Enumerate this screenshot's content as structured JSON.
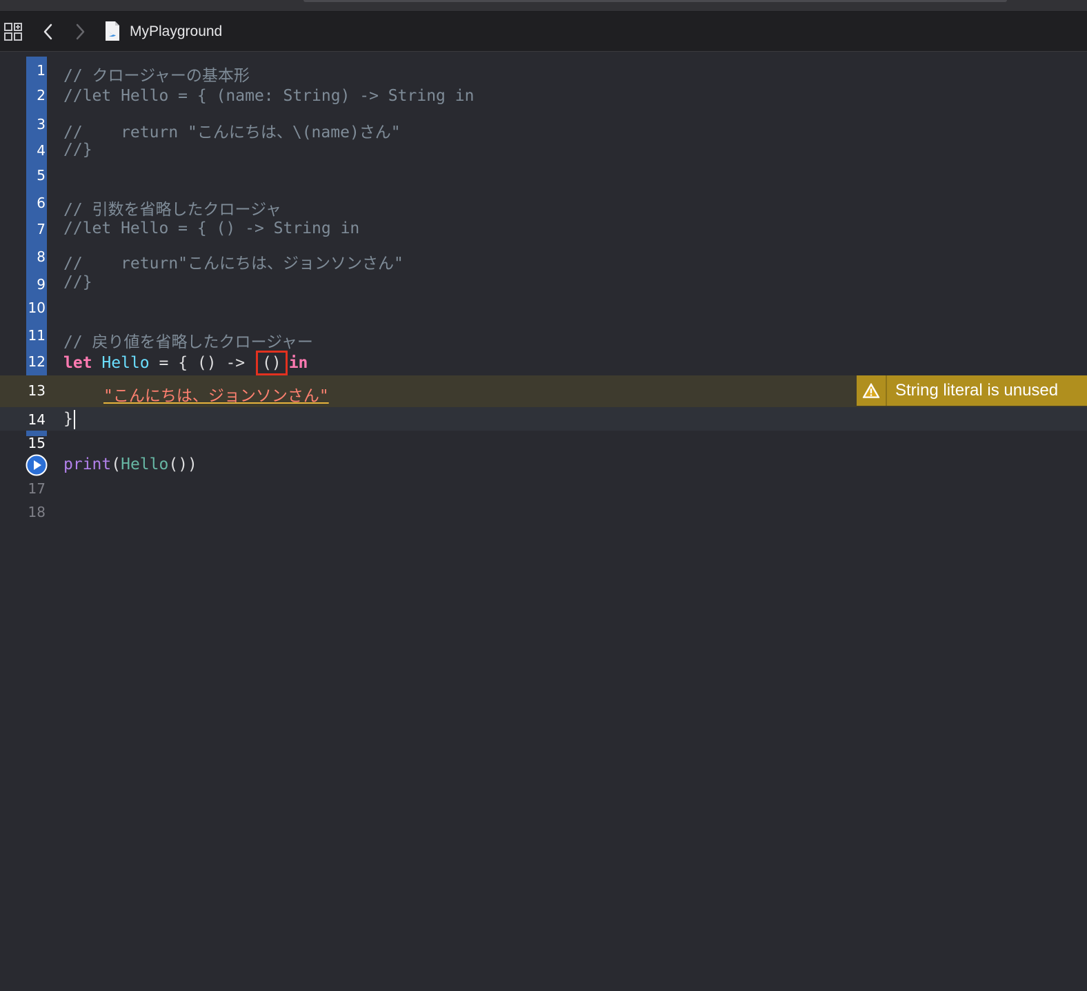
{
  "window": {
    "file_title": "MyPlayground"
  },
  "editor": {
    "lines": [
      {
        "number": "1",
        "text": "// クロージャーの基本形"
      },
      {
        "number": "2",
        "text": "//let Hello = { (name: String) -> String in"
      },
      {
        "number": "3",
        "text": "//    return \"こんにちは、\\(name)さん\""
      },
      {
        "number": "4",
        "text": "//}"
      },
      {
        "number": "5",
        "text": ""
      },
      {
        "number": "6",
        "text": "// 引数を省略したクロージャ"
      },
      {
        "number": "7",
        "text": "//let Hello = { () -> String in"
      },
      {
        "number": "8",
        "text": "//    return\"こんにちは、ジョンソンさん\""
      },
      {
        "number": "9",
        "text": "//}"
      },
      {
        "number": "10",
        "text": ""
      },
      {
        "number": "11",
        "text": "// 戻り値を省略したクロージャー"
      },
      {
        "number": "12",
        "tokens": {
          "kw_let": "let",
          "name": "Hello",
          "mid": "= { () ->",
          "boxed": "()",
          "kw_in": "in"
        }
      },
      {
        "number": "13",
        "tokens": {
          "string": "\"こんにちは、ジョンソンさん\""
        }
      },
      {
        "number": "14",
        "text": "}"
      },
      {
        "number": "15",
        "text": ""
      },
      {
        "number": "16",
        "tokens": {
          "fn": "print",
          "open": "(",
          "name": "Hello",
          "close": "())"
        }
      },
      {
        "number": "17",
        "text": ""
      },
      {
        "number": "18",
        "text": ""
      }
    ]
  },
  "warning": {
    "message": "String literal is unused",
    "icon": "warning-triangle-icon",
    "color": "#b08f1e"
  },
  "colors": {
    "background": "#292a30",
    "comment": "#7f8c98",
    "keyword": "#ff7ab2",
    "string": "#ff8170",
    "gutter_highlight": "#3561a8",
    "annotation_box": "#e2311f"
  }
}
